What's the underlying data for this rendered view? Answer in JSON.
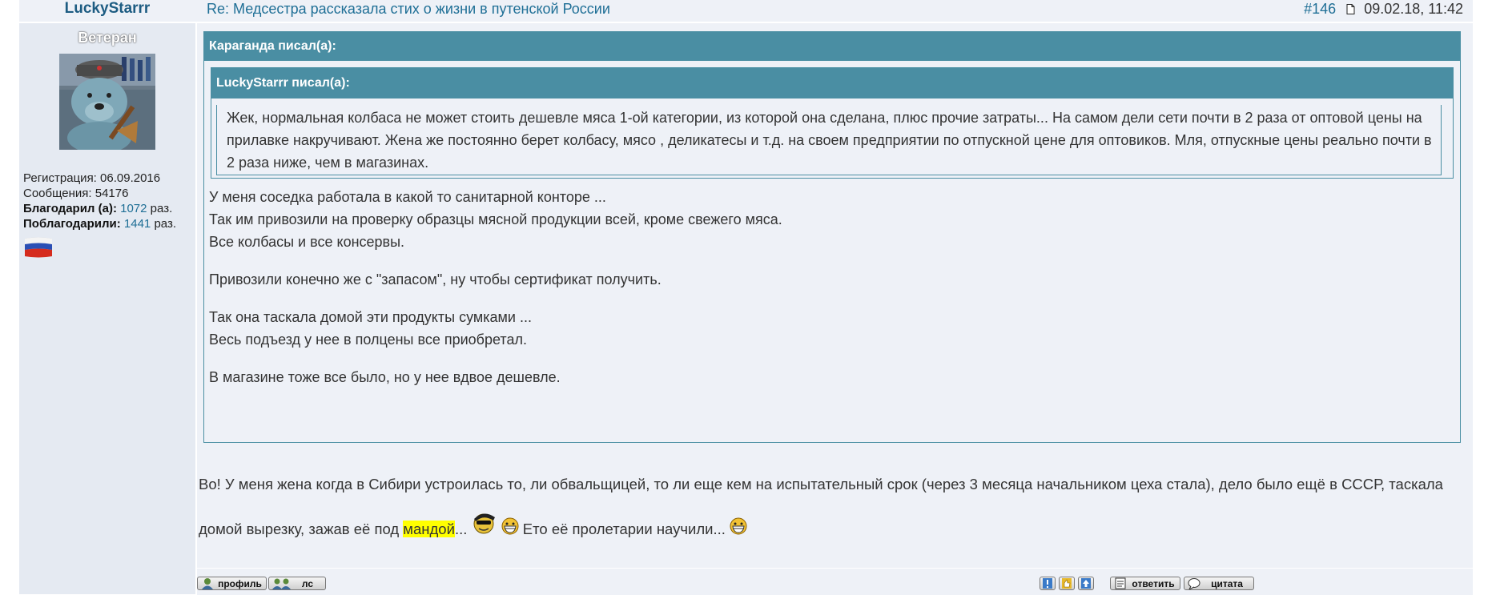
{
  "post": {
    "author": "LuckyStarrr",
    "title": "Re: Медсестра рассказала стих о жизни в путенской России",
    "number": "#146",
    "datetime": "09.02.18, 11:42"
  },
  "profile": {
    "rank": "Ветеран",
    "reg_label": "Регистрация:",
    "reg_value": "06.09.2016",
    "msgs_label": "Сообщения:",
    "msgs_value": "54176",
    "thanked_label": "Благодарил (а):",
    "thanked_value": "1072",
    "thanked_unit": "раз.",
    "was_thanked_label": "Поблагодарили:",
    "was_thanked_value": "1441",
    "was_thanked_unit": "раз."
  },
  "quote_outer": {
    "header": "Караганда писал(а):",
    "lines": [
      "У меня соседка работала в какой то санитарной конторе ...",
      "Так им привозили на проверку образцы мясной продукции всей, кроме свежего мяса.",
      "Все колбасы и все консервы.",
      "Привозили конечно же с \"запасом\", ну чтобы сертификат получить.",
      "Так она таскала домой эти продукты сумками ...",
      "Весь подъезд у нее в полцены все приобретал.",
      "В магазине тоже все было, но у нее вдвое дешевле."
    ]
  },
  "quote_inner": {
    "header": "LuckyStarrr писал(а):",
    "text": "Жек, нормальная колбаса не может стоить дешевле мяса 1-ой категории, из которой она сделана, плюс прочие затраты... На самом дели сети почти в 2 раза от оптовой цены на прилавке накручивают. Жена же постоянно берет колбасу, мясо , деликатесы и т.д. на своем предприятии по отпускной цене для оптовиков. Мля, отпускные цены реально почти в 2 раза ниже, чем в магазинах."
  },
  "reply": {
    "part1": "Во! У меня жена когда в Сибири устроилась то, ли обвальщицей, то ли еще кем на испытательный срок (через 3 месяца начальником цеха стала), дело было ещё в СССР, таскала домой вырезку, зажав её под ",
    "highlight": "мандой",
    "part2": "...",
    "part3": " Ето её пролетарии научили..."
  },
  "buttons": {
    "profile": "профиль",
    "pm": "лс",
    "reply": "ответить",
    "quote": "цитата"
  },
  "icons": {
    "doc": "document-icon",
    "report": "exclamation-icon",
    "thanks": "thumbs-up-icon",
    "top": "arrow-up-icon"
  }
}
